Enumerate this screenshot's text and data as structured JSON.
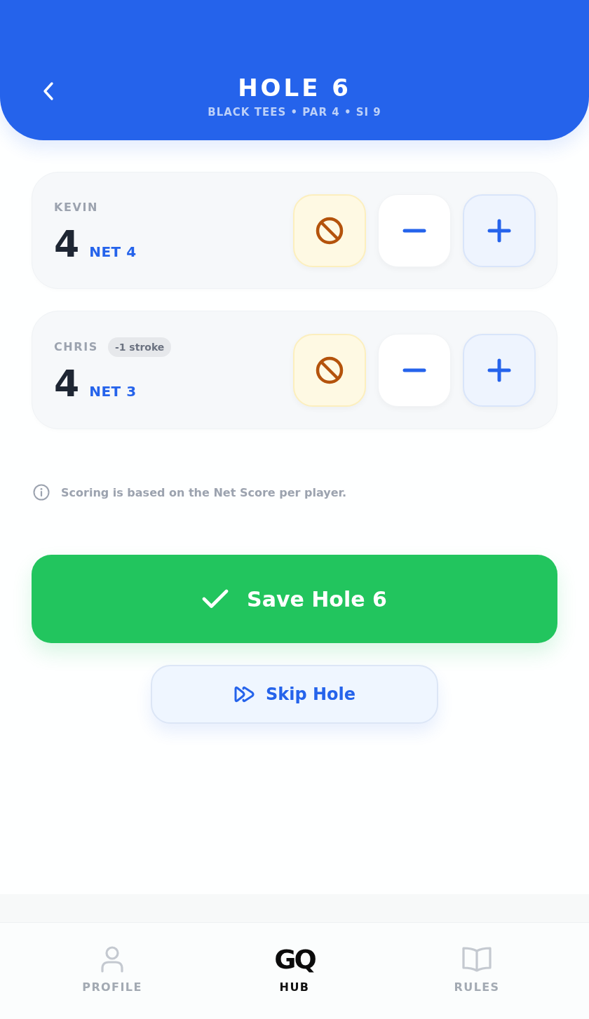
{
  "header": {
    "title": "HOLE 6",
    "subtitle": "BLACK TEES • PAR 4 • SI 9"
  },
  "players": [
    {
      "name": "KEVIN",
      "score": "4",
      "net": "NET 4"
    },
    {
      "name": "CHRIS",
      "badge": "-1 stroke",
      "score": "4",
      "net": "NET 3"
    }
  ],
  "info": "Scoring is based on the Net Score per player.",
  "actions": {
    "save": "Save Hole 6",
    "skip": "Skip Hole"
  },
  "nav": [
    {
      "kind": "profile",
      "label": "PROFILE",
      "selected": false
    },
    {
      "kind": "logo",
      "logo_text": "GQ",
      "label": "HUB",
      "selected": true
    },
    {
      "kind": "rules",
      "label": "RULES",
      "selected": false
    }
  ]
}
